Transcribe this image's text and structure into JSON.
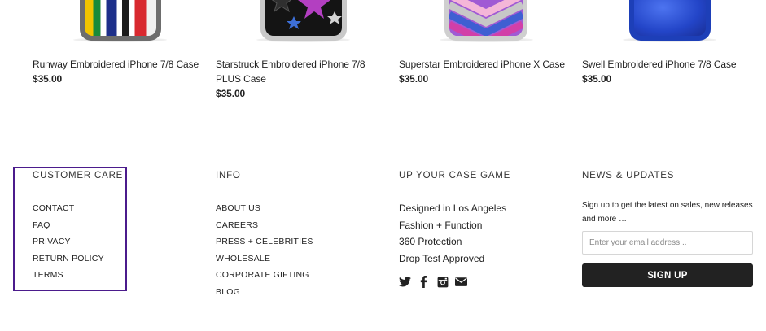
{
  "products": [
    {
      "title": "Runway Embroidered iPhone 7/8 Case",
      "price": "$35.00"
    },
    {
      "title": "Starstruck Embroidered iPhone 7/8 PLUS Case",
      "price": "$35.00"
    },
    {
      "title": "Superstar Embroidered iPhone X Case",
      "price": "$35.00"
    },
    {
      "title": "Swell Embroidered iPhone 7/8 Case",
      "price": "$35.00"
    }
  ],
  "footer": {
    "customer_care": {
      "heading": "CUSTOMER CARE",
      "links": [
        "CONTACT",
        "FAQ",
        "PRIVACY",
        "RETURN POLICY",
        "TERMS"
      ]
    },
    "info": {
      "heading": "INFO",
      "links": [
        "ABOUT US",
        "CAREERS",
        "PRESS + CELEBRITIES",
        "WHOLESALE",
        "CORPORATE GIFTING",
        "BLOG"
      ]
    },
    "case_game": {
      "heading": "UP YOUR CASE GAME",
      "items": [
        "Designed in Los Angeles",
        "Fashion + Function",
        "360 Protection",
        "Drop Test Approved"
      ],
      "social_icons": [
        "twitter-icon",
        "facebook-icon",
        "instagram-icon",
        "email-icon"
      ]
    },
    "news": {
      "heading": "NEWS & UPDATES",
      "text": "Sign up to get the latest on sales, new releases and more …",
      "email_placeholder": "Enter your email address...",
      "signup_label": "SIGN UP"
    }
  },
  "colors": {
    "highlight_border": "#4b1b8c",
    "button_bg": "#222222",
    "divider": "#333333"
  }
}
